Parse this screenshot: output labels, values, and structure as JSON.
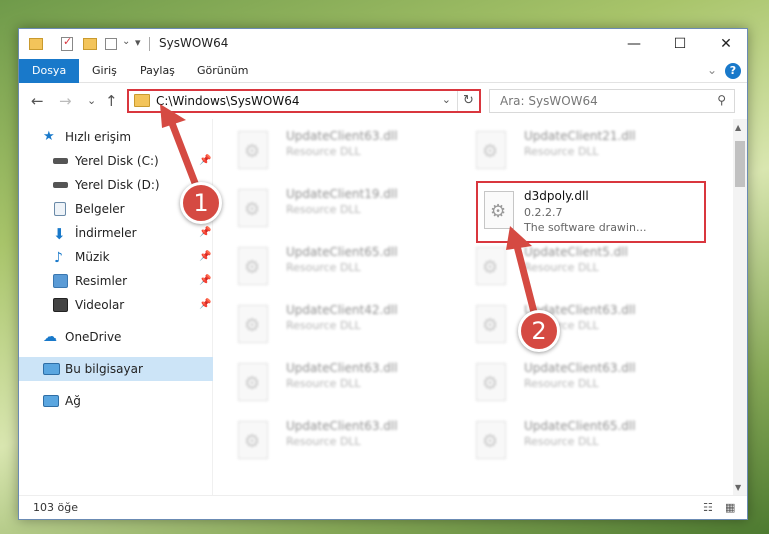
{
  "window": {
    "title": "SysWOW64",
    "controls": {
      "minimize": "—",
      "maximize": "☐",
      "close": "✕"
    }
  },
  "ribbon": {
    "tabs": [
      "Dosya",
      "Giriş",
      "Paylaş",
      "Görünüm"
    ],
    "help": "?",
    "collapse": "⌄"
  },
  "navigation": {
    "back": "←",
    "forward": "→",
    "recent": "⌄",
    "up": "↑",
    "address": "C:\\Windows\\SysWOW64",
    "address_dropdown": "⌄",
    "refresh": "↻",
    "search_placeholder": "Ara: SysWOW64",
    "search_icon": "⚲"
  },
  "sidebar": {
    "items": [
      {
        "label": "Hızlı erişim",
        "icon": "star-icon",
        "pinned": false
      },
      {
        "label": "Yerel Disk (C:)",
        "icon": "drive-icon",
        "pinned": true
      },
      {
        "label": "Yerel Disk (D:)",
        "icon": "drive-icon",
        "pinned": false
      },
      {
        "label": "Belgeler",
        "icon": "document-icon",
        "pinned": true
      },
      {
        "label": "İndirmeler",
        "icon": "download-icon",
        "pinned": true
      },
      {
        "label": "Müzik",
        "icon": "music-icon",
        "pinned": true
      },
      {
        "label": "Resimler",
        "icon": "picture-icon",
        "pinned": true
      },
      {
        "label": "Videolar",
        "icon": "video-icon",
        "pinned": true
      },
      {
        "label": "OneDrive",
        "icon": "cloud-icon",
        "pinned": false
      },
      {
        "label": "Bu bilgisayar",
        "icon": "computer-icon",
        "pinned": false,
        "selected": true
      },
      {
        "label": "Ağ",
        "icon": "network-icon",
        "pinned": false
      }
    ],
    "pin_glyph": "📌"
  },
  "files": {
    "left_column": [
      {
        "name": "UpdateClient63.dll",
        "desc": "Resource DLL"
      },
      {
        "name": "UpdateClient19.dll",
        "desc": "Resource DLL"
      },
      {
        "name": "UpdateClient65.dll",
        "desc": "Resource DLL"
      },
      {
        "name": "UpdateClient42.dll",
        "desc": "Resource DLL"
      },
      {
        "name": "UpdateClient63.dll",
        "desc": "Resource DLL"
      },
      {
        "name": "UpdateClient63.dll",
        "desc": "Resource DLL"
      }
    ],
    "right_column": [
      {
        "name": "UpdateClient21.dll",
        "desc": "Resource DLL"
      },
      {
        "name": "UpdateClient5.dll",
        "desc": "Resource DLL"
      },
      {
        "name": "UpdateClient63.dll",
        "desc": "Resource DLL"
      },
      {
        "name": "UpdateClient63.dll",
        "desc": "Resource DLL"
      },
      {
        "name": "UpdateClient65.dll",
        "desc": "Resource DLL"
      }
    ],
    "highlighted": {
      "name": "d3dpoly.dll",
      "version": "0.2.2.7",
      "desc": "The software drawin..."
    }
  },
  "status": {
    "count": "103 öğe",
    "view_details": "☷",
    "view_tiles": "▦"
  },
  "annotations": {
    "step1": "1",
    "step2": "2",
    "color": "#d54a42"
  }
}
